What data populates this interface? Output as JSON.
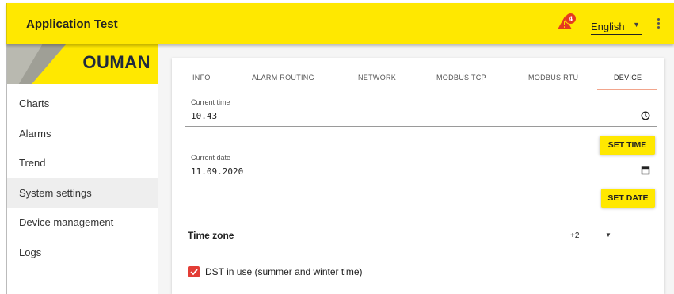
{
  "header": {
    "title": "Application Test",
    "alarm_count": "4",
    "language": "English",
    "colors": {
      "bar": "#ffe800",
      "alarm": "#e53a1f"
    }
  },
  "sidebar": {
    "logo_text": "OUMAN",
    "items": [
      {
        "label": "Charts",
        "active": false
      },
      {
        "label": "Alarms",
        "active": false
      },
      {
        "label": "Trend",
        "active": false
      },
      {
        "label": "System settings",
        "active": true
      },
      {
        "label": "Device management",
        "active": false
      },
      {
        "label": "Logs",
        "active": false
      }
    ]
  },
  "tabs": [
    {
      "label": "INFO",
      "active": false
    },
    {
      "label": "ALARM ROUTING",
      "active": false
    },
    {
      "label": "NETWORK",
      "active": false
    },
    {
      "label": "MODBUS TCP",
      "active": false
    },
    {
      "label": "MODBUS RTU",
      "active": false
    },
    {
      "label": "DEVICE",
      "active": true
    }
  ],
  "device": {
    "current_time": {
      "label": "Current time",
      "value": "10.43",
      "icon": "clock-icon"
    },
    "set_time_label": "SET TIME",
    "current_date": {
      "label": "Current date",
      "value": "11.09.2020",
      "icon": "calendar-icon"
    },
    "set_date_label": "SET DATE",
    "time_zone": {
      "label": "Time zone",
      "value": "+2"
    },
    "dst": {
      "label": "DST in use (summer and winter time)",
      "checked": true
    }
  }
}
